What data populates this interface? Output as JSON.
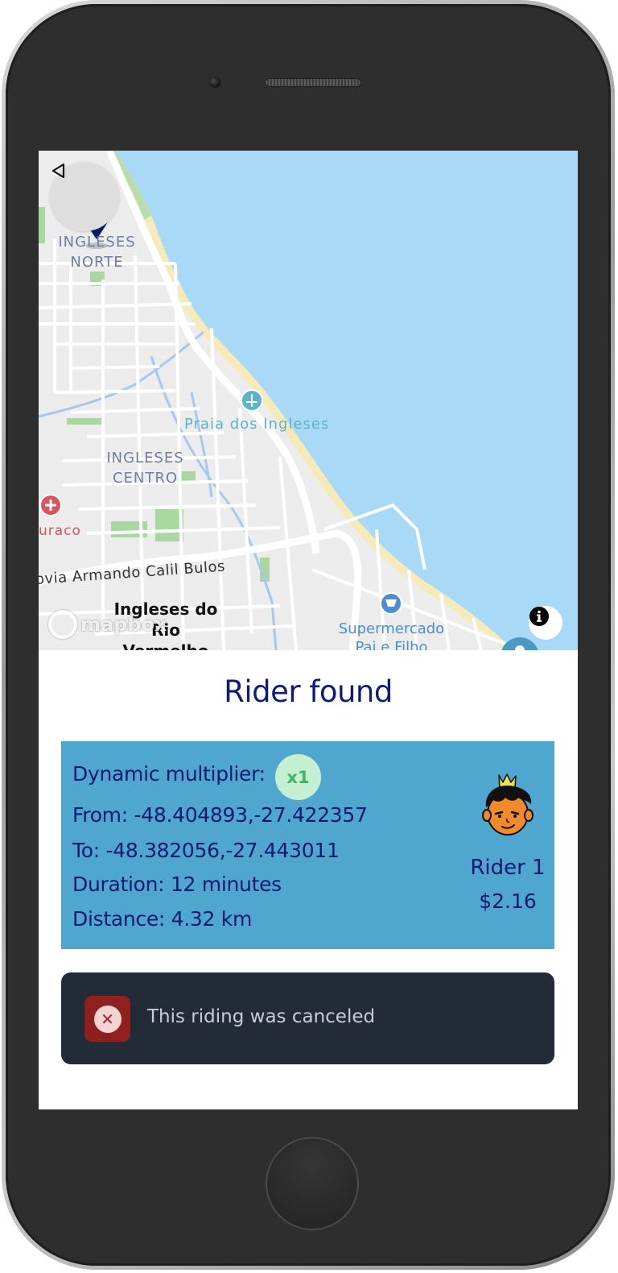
{
  "map": {
    "labels": {
      "district_north_line1": "INGLESES",
      "district_north_line2": "NORTE",
      "beach": "Praia dos Ingleses",
      "district_center_line1": "INGLESES",
      "district_center_line2": "CENTRO",
      "partial_place": "uraco",
      "street": "ovia Armando Calil Bulos",
      "place_line1": "Ingleses do",
      "place_line2": "Rio Vermelho",
      "market_line1": "Supermercado",
      "market_line2": "Pai e Filho"
    },
    "attribution_logo": "mapbox",
    "colors": {
      "water": "#a8daf7",
      "land": "#ececec",
      "road": "#ffffff",
      "park": "#a8d8a0",
      "pin": "#0a1a6e"
    }
  },
  "ride": {
    "title": "Rider found",
    "multiplier_label": "Dynamic multiplier:",
    "multiplier_value": "x1",
    "from": "From: -48.404893,-27.422357",
    "to": "To: -48.382056,-27.443011",
    "duration": "Duration: 12 minutes",
    "distance": "Distance: 4.32 km",
    "rider_name": "Rider 1",
    "price": "$2.16"
  },
  "toast": {
    "message": "This riding was canceled",
    "icon": "close-circle-icon"
  },
  "colors": {
    "accent": "#101c7a",
    "card": "#4fa7cf",
    "badge_bg": "#c5efd1",
    "badge_text": "#3fb36a",
    "toast_bg": "#232a38",
    "toast_icon_bg": "#8e2120"
  }
}
